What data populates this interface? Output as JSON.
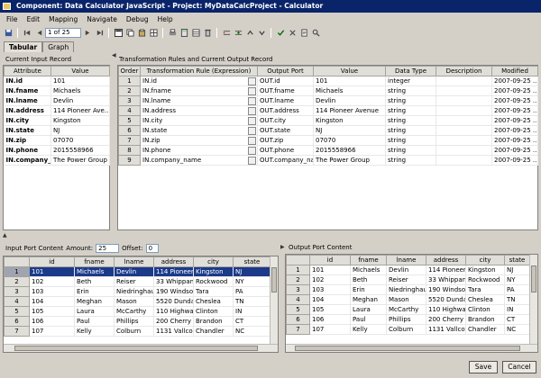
{
  "window": {
    "title": "Component: Data Calculator JavaScript - Project: MyDataCalcProject - Calculator"
  },
  "menu": [
    "File",
    "Edit",
    "Mapping",
    "Navigate",
    "Debug",
    "Help"
  ],
  "toolbar": {
    "page": "1 of 25"
  },
  "tabs": [
    "Tabular",
    "Graph"
  ],
  "input_record": {
    "title": "Current Input Record",
    "columns": [
      "Attribute",
      "Value"
    ],
    "rows": [
      [
        "IN.id",
        "101"
      ],
      [
        "IN.fname",
        "Michaels"
      ],
      [
        "IN.lname",
        "Devlin"
      ],
      [
        "IN.address",
        "114 Pioneer Ave..."
      ],
      [
        "IN.city",
        "Kingston"
      ],
      [
        "IN.state",
        "NJ"
      ],
      [
        "IN.zip",
        "07070"
      ],
      [
        "IN.phone",
        "2015558966"
      ],
      [
        "IN.company_...",
        "The Power Group"
      ]
    ]
  },
  "rules": {
    "title": "Transformation Rules and Current Output Record",
    "columns": [
      "Order",
      "Transformation Rule (Expression)",
      "Output Port",
      "Value",
      "Data Type",
      "Description",
      "Modified"
    ],
    "rows": [
      [
        "1",
        "IN.id",
        "OUT.id",
        "101",
        "integer",
        "",
        "2007-09-25 ..."
      ],
      [
        "2",
        "IN.fname",
        "OUT.fname",
        "Michaels",
        "string",
        "",
        "2007-09-25 ..."
      ],
      [
        "3",
        "IN.lname",
        "OUT.lname",
        "Devlin",
        "string",
        "",
        "2007-09-25 ..."
      ],
      [
        "4",
        "IN.address",
        "OUT.address",
        "114 Pioneer Avenue",
        "string",
        "",
        "2007-09-25 ..."
      ],
      [
        "5",
        "IN.city",
        "OUT.city",
        "Kingston",
        "string",
        "",
        "2007-09-25 ..."
      ],
      [
        "6",
        "IN.state",
        "OUT.state",
        "NJ",
        "string",
        "",
        "2007-09-25 ..."
      ],
      [
        "7",
        "IN.zip",
        "OUT.zip",
        "07070",
        "string",
        "",
        "2007-09-25 ..."
      ],
      [
        "8",
        "IN.phone",
        "OUT.phone",
        "2015558966",
        "string",
        "",
        "2007-09-25 ..."
      ],
      [
        "9",
        "IN.company_name",
        "OUT.company_name",
        "The Power Group",
        "string",
        "",
        "2007-09-25 ..."
      ]
    ]
  },
  "input_port": {
    "title": "Input Port Content",
    "amount_label": "Amount:",
    "amount": "25",
    "offset_label": "Offset:",
    "offset": "0",
    "columns": [
      "",
      "id",
      "fname",
      "lname",
      "address",
      "city",
      "state"
    ],
    "rows": [
      [
        "1",
        "101",
        "Michaels",
        "Devlin",
        "114 Pioneer ...",
        "Kingston",
        "NJ"
      ],
      [
        "2",
        "102",
        "Beth",
        "Reiser",
        "33 Whippan...",
        "Rockwood",
        "NY"
      ],
      [
        "3",
        "103",
        "Erin",
        "Niedringhaus",
        "190 Windsor...",
        "Tara",
        "PA"
      ],
      [
        "4",
        "104",
        "Meghan",
        "Mason",
        "5520 Dunda...",
        "Cheslea",
        "TN"
      ],
      [
        "5",
        "105",
        "Laura",
        "McCarthy",
        "110 Highwa...",
        "Clinton",
        "IN"
      ],
      [
        "6",
        "106",
        "Paul",
        "Phillips",
        "200 Cherry ...",
        "Brandon",
        "CT"
      ],
      [
        "7",
        "107",
        "Kelly",
        "Colburn",
        "1131 Vallco ...",
        "Chandler",
        "NC"
      ]
    ]
  },
  "output_port": {
    "title": "Output Port Content",
    "columns": [
      "",
      "id",
      "fname",
      "lname",
      "address",
      "city",
      "state"
    ],
    "rows": [
      [
        "1",
        "101",
        "Michaels",
        "Devlin",
        "114 Pioneer ...",
        "Kingston",
        "NJ"
      ],
      [
        "2",
        "102",
        "Beth",
        "Reiser",
        "33 Whippan...",
        "Rockwood",
        "NY"
      ],
      [
        "3",
        "103",
        "Erin",
        "Niedringhaus",
        "190 Windsor...",
        "Tara",
        "PA"
      ],
      [
        "4",
        "104",
        "Meghan",
        "Mason",
        "5520 Dunda...",
        "Cheslea",
        "TN"
      ],
      [
        "5",
        "105",
        "Laura",
        "McCarthy",
        "110 Highwa...",
        "Clinton",
        "IN"
      ],
      [
        "6",
        "106",
        "Paul",
        "Phillips",
        "200 Cherry ...",
        "Brandon",
        "CT"
      ],
      [
        "7",
        "107",
        "Kelly",
        "Colburn",
        "1131 Vallco ...",
        "Chandler",
        "NC"
      ]
    ]
  },
  "buttons": {
    "save": "Save",
    "cancel": "Cancel"
  },
  "colors": {
    "title_bg": "#0a246a",
    "selection": "#1b3a8a"
  }
}
